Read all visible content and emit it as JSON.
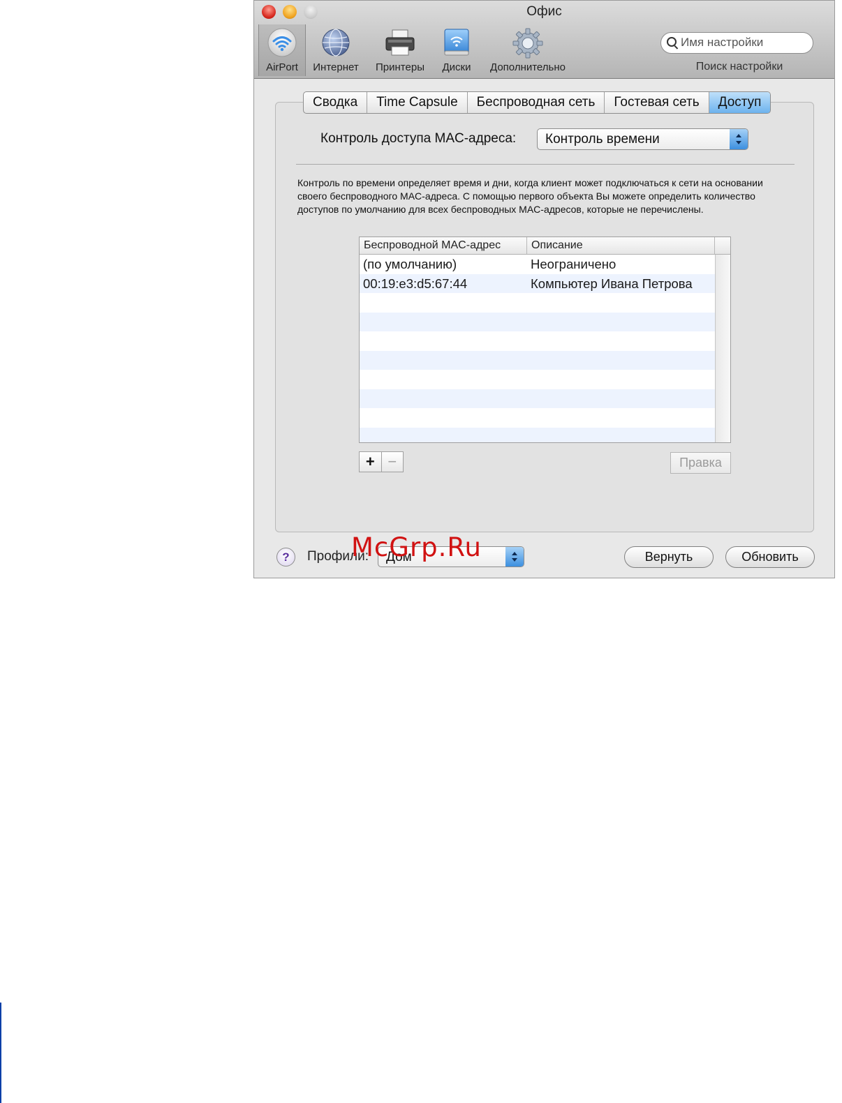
{
  "window": {
    "title": "Офис"
  },
  "toolbar": {
    "items": [
      {
        "label": "AirPort",
        "icon": "airport-wifi-icon"
      },
      {
        "label": "Интернет",
        "icon": "globe-icon"
      },
      {
        "label": "Принтеры",
        "icon": "printer-icon"
      },
      {
        "label": "Диски",
        "icon": "disk-icon"
      },
      {
        "label": "Дополнительно",
        "icon": "gear-icon"
      }
    ],
    "search": {
      "placeholder": "Имя настройки",
      "caption": "Поиск настройки"
    }
  },
  "tabs": [
    {
      "label": "Сводка",
      "active": false
    },
    {
      "label": "Time Capsule",
      "active": false
    },
    {
      "label": "Беспроводная сеть",
      "active": false
    },
    {
      "label": "Гостевая сеть",
      "active": false
    },
    {
      "label": "Доступ",
      "active": true
    }
  ],
  "access": {
    "mac_control_label": "Контроль доступа MAC-адреса:",
    "mac_control_value": "Контроль времени",
    "description": "Контроль по времени определяет время и дни, когда клиент может подключаться к сети на основании своего беспроводного MAC-адреса. С помощью первого объекта Вы можете определить количество доступов по умолчанию для всех беспроводных MAC-адресов, которые не перечислены."
  },
  "table": {
    "columns": [
      "Беспроводной MAC-адрес",
      "Описание"
    ],
    "rows": [
      {
        "mac": "(по умолчанию)",
        "description": "Неограничено"
      },
      {
        "mac": "00:19:e3:d5:67:44",
        "description": "Компьютер Ивана Петрова"
      }
    ],
    "add_symbol": "+",
    "remove_symbol": "−",
    "edit_label": "Правка"
  },
  "footer": {
    "help_symbol": "?",
    "profile_label": "Профили:",
    "profile_value": "Дом",
    "revert_label": "Вернуть",
    "update_label": "Обновить"
  },
  "watermark": "McGrp.Ru",
  "colors": {
    "active_tab": "#6db3ee",
    "row_stripe": "#edf3fe",
    "watermark": "#d11212",
    "page_rule": "#0a3fa8"
  }
}
